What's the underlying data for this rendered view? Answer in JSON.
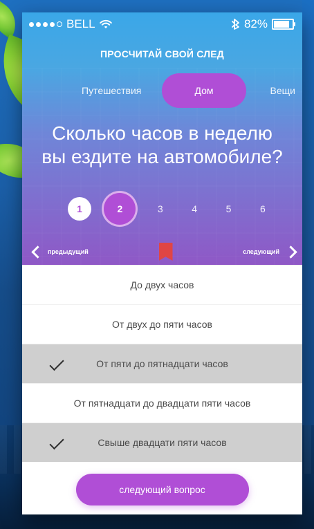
{
  "status_bar": {
    "carrier": "BELL",
    "battery": "82%"
  },
  "header": {
    "title": "ПРОСЧИТАЙ СВОЙ СЛЕД"
  },
  "tabs": [
    {
      "label": "Путешествия"
    },
    {
      "label": "Дом",
      "active": true
    },
    {
      "label": "Вещи"
    }
  ],
  "question": {
    "line1": "Сколько часов в неделю",
    "line2": "вы ездите на автомобиле?"
  },
  "steps": [
    {
      "label": "1"
    },
    {
      "label": "2"
    },
    {
      "label": "3"
    },
    {
      "label": "4"
    },
    {
      "label": "5"
    },
    {
      "label": "6"
    }
  ],
  "nav": {
    "prev": "предыдущий",
    "next": "следующий"
  },
  "answers": [
    {
      "label": "До двух часов",
      "selected": false
    },
    {
      "label": "От двух до пяти часов",
      "selected": false
    },
    {
      "label": "От пяти до пятнадцати часов",
      "selected": true
    },
    {
      "label": "От пятнадцати до двадцати пяти часов",
      "selected": false
    },
    {
      "label": "Свыше двадцати пяти часов",
      "selected": true
    }
  ],
  "cta": {
    "label": "следующий вопрос"
  },
  "colors": {
    "accent": "#b04ed6",
    "bookmark": "#e04545"
  }
}
